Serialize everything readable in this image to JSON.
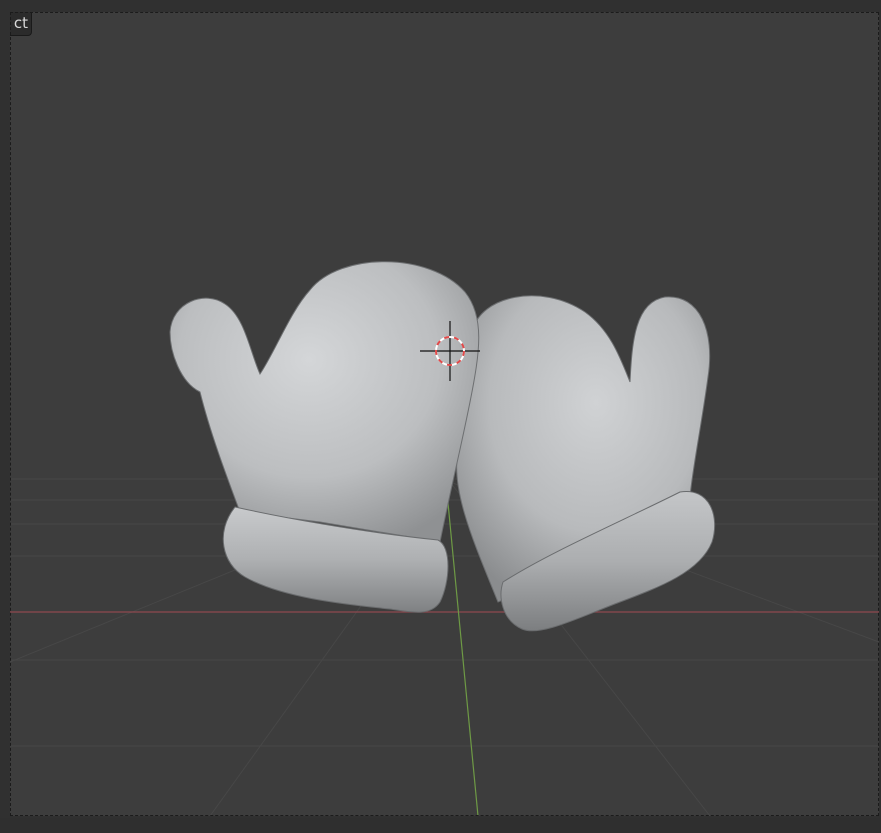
{
  "header": {
    "mode_label": "ct"
  },
  "viewport": {
    "background_color": "#3d3d3d",
    "grid_color": "#474747",
    "x_axis_color": "#8e4a50",
    "y_axis_color": "#6e9a45"
  },
  "scene": {
    "objects": [
      {
        "name": "left-mitten",
        "color": "#c6c8ca"
      },
      {
        "name": "right-mitten",
        "color": "#c6c8ca"
      }
    ],
    "cursor": {
      "name": "3d-cursor",
      "ring_colors": [
        "#e04a4a",
        "#ffffff"
      ]
    }
  }
}
